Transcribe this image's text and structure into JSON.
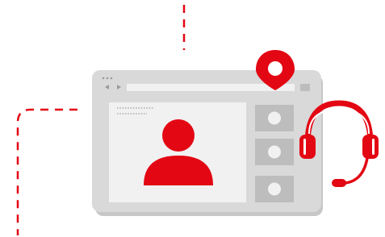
{
  "illustration": {
    "accent_color": "#e30613",
    "window_frame_color": "#d9d9d9",
    "window_shadow_color": "#c7c7c7",
    "panel_color": "#f1f1f1",
    "thumbnail_color": "#bdbdbd",
    "dot_color": "#9a9a9a",
    "icons": [
      "location-pin-icon",
      "headset-icon",
      "person-avatar-icon",
      "back-arrow-icon",
      "forward-arrow-icon"
    ]
  }
}
